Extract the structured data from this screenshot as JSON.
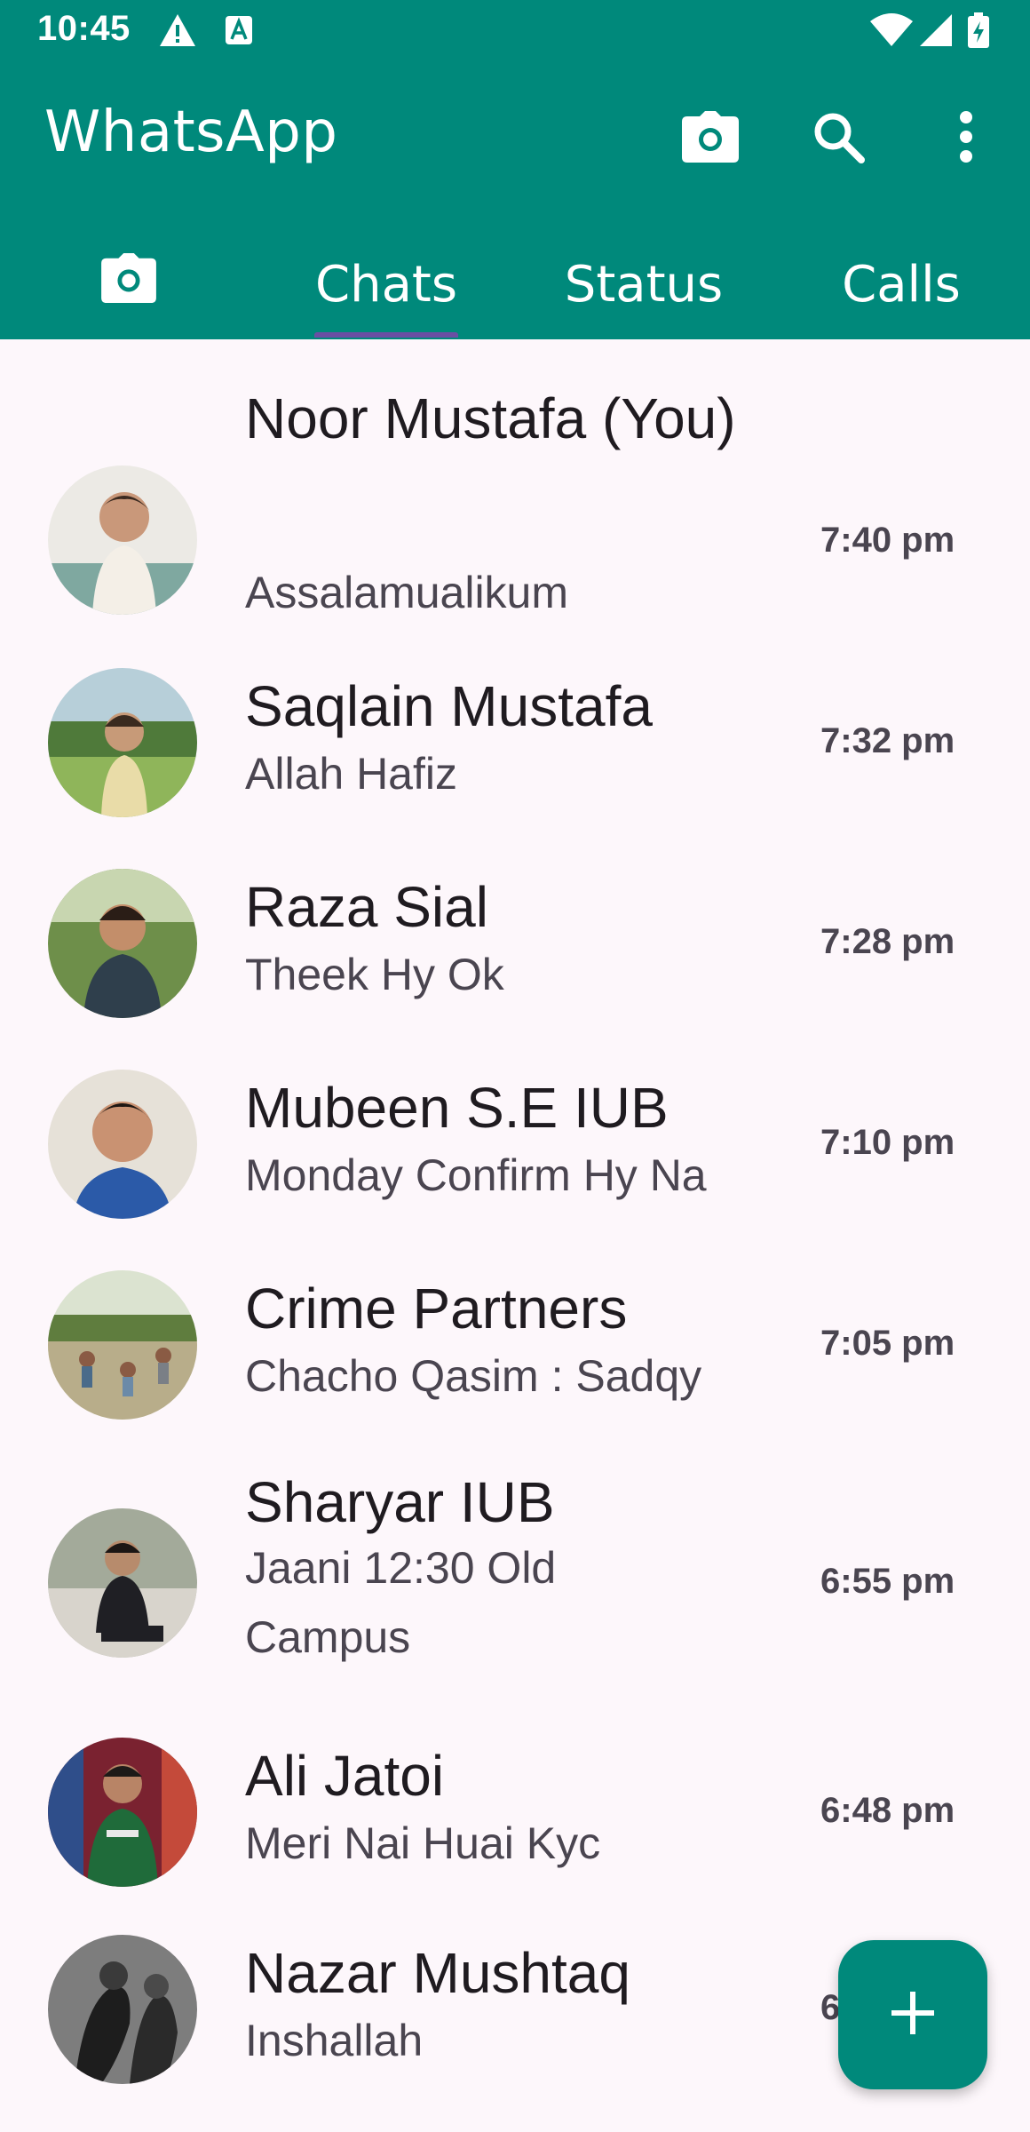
{
  "status_bar": {
    "time": "10:45",
    "icons": [
      "alert-triangle-icon",
      "a-box-icon",
      "wifi-icon",
      "cellular-icon",
      "battery-charging-icon"
    ]
  },
  "app_bar": {
    "title": "WhatsApp",
    "actions": [
      "camera-icon",
      "search-icon",
      "more-vert-icon"
    ]
  },
  "tabs": {
    "camera_icon": "camera-icon",
    "items": [
      {
        "label": "Chats",
        "selected": true
      },
      {
        "label": "Status",
        "selected": false
      },
      {
        "label": "Calls",
        "selected": false
      }
    ]
  },
  "chats": [
    {
      "name": "Noor Mustafa (You)",
      "message": "Assalamualikum",
      "time": "7:40 pm"
    },
    {
      "name": "Saqlain Mustafa",
      "message": "Allah Hafiz",
      "time": "7:32 pm"
    },
    {
      "name": "Raza Sial",
      "message": "Theek Hy Ok",
      "time": "7:28 pm"
    },
    {
      "name": "Mubeen S.E IUB",
      "message": "Monday Confirm Hy Na",
      "time": "7:10 pm"
    },
    {
      "name": "Crime Partners",
      "message": "Chacho Qasim : Sadqy",
      "time": "7:05 pm"
    },
    {
      "name": "Sharyar IUB",
      "message": "Jaani 12:30 Old Campus",
      "time": "6:55 pm"
    },
    {
      "name": "Ali Jatoi",
      "message": "Meri Nai Huai Kyc",
      "time": "6:48 pm"
    },
    {
      "name": "Nazar Mushtaq",
      "message": "Inshallah",
      "time": "6"
    }
  ],
  "fab": {
    "icon": "plus-icon"
  },
  "colors": {
    "primary": "#00897b",
    "background": "#fdf7fb",
    "indicator": "#6a4fa3"
  }
}
